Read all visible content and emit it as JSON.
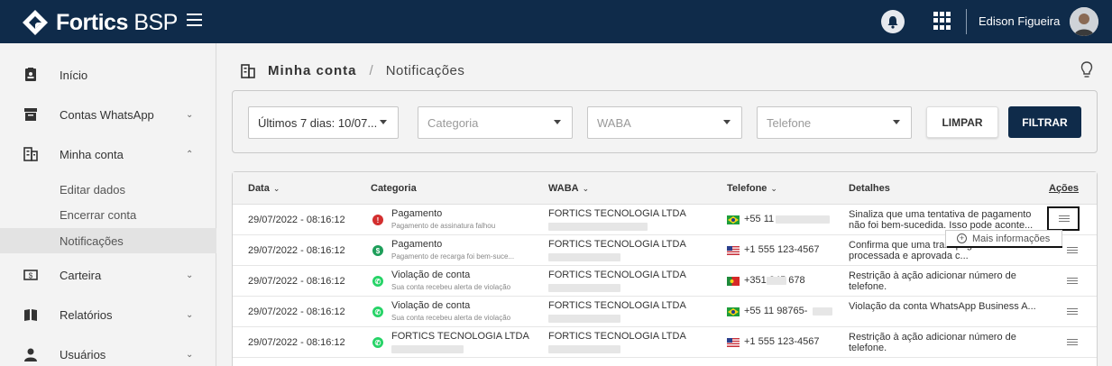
{
  "app": {
    "brand_bold": "Fortics",
    "brand_light": "BSP"
  },
  "header": {
    "user_name": "Edison Figueira"
  },
  "sidebar": {
    "items": [
      {
        "label": "Início",
        "icon": "badge-icon"
      },
      {
        "label": "Contas WhatsApp",
        "icon": "archive-icon"
      },
      {
        "label": "Minha conta",
        "icon": "building-icon"
      },
      {
        "label": "Carteira",
        "icon": "wallet-icon"
      },
      {
        "label": "Relatórios",
        "icon": "book-icon"
      },
      {
        "label": "Usuários",
        "icon": "user-icon"
      }
    ],
    "subitems": [
      "Editar dados",
      "Encerrar conta",
      "Notificações"
    ]
  },
  "breadcrumb": {
    "root": "Minha conta",
    "separator": "/",
    "current": "Notificações"
  },
  "filters": {
    "period": "Últimos 7 dias: 10/07...",
    "categoria_placeholder": "Categoria",
    "waba_placeholder": "WABA",
    "telefone_placeholder": "Telefone",
    "clear_label": "LIMPAR",
    "filter_label": "FILTRAR"
  },
  "table": {
    "headers": {
      "data": "Data",
      "categoria": "Categoria",
      "waba": "WABA",
      "telefone": "Telefone",
      "detalhes": "Detalhes",
      "acoes": "Ações"
    },
    "rows": [
      {
        "date": "29/07/2022 - 08:16:12",
        "cat_title": "Pagamento",
        "cat_sub": "Pagamento de assinatura falhou",
        "cat_icon": "error",
        "waba": "FORTICS TECNOLOGIA LTDA",
        "flag": "br",
        "phone": "+55 11",
        "details": "Sinaliza que uma tentativa de pagamento não foi bem-sucedida. Isso pode aconte..."
      },
      {
        "date": "29/07/2022 - 08:16:12",
        "cat_title": "Pagamento",
        "cat_sub": "Pagamento de recarga foi bem-suce...",
        "cat_icon": "success",
        "waba": "FORTICS TECNOLOGIA LTDA",
        "flag": "us",
        "phone": "+1 555 123-4567",
        "details": "Confirma que uma tra... pagamento foi processada e aprovada c..."
      },
      {
        "date": "29/07/2022 - 08:16:12",
        "cat_title": "Violação de conta",
        "cat_sub": "Sua conta recebeu alerta de violação",
        "cat_icon": "whatsapp",
        "waba": "FORTICS TECNOLOGIA LTDA",
        "flag": "pt",
        "phone": "+351       345 678",
        "details": "Restrição à ação adicionar número de telefone."
      },
      {
        "date": "29/07/2022 - 08:16:12",
        "cat_title": "Violação de conta",
        "cat_sub": "Sua conta recebeu alerta de violação",
        "cat_icon": "whatsapp",
        "waba": "FORTICS TECNOLOGIA LTDA",
        "flag": "br",
        "phone": "+55 11 98765-",
        "details": "Violação da conta WhatsApp Business A..."
      },
      {
        "date": "29/07/2022 - 08:16:12",
        "cat_title": "FORTICS TECNOLOGIA LTDA",
        "cat_sub": "",
        "cat_icon": "whatsapp",
        "waba": "FORTICS TECNOLOGIA LTDA",
        "flag": "us",
        "phone": "+1 555 123-4567",
        "details": "Restrição à ação adicionar número de telefone."
      }
    ]
  },
  "tooltip": {
    "label": "Mais informações"
  },
  "colors": {
    "navy": "#0f2b4a",
    "error": "#d32f2f",
    "success": "#1e9e5a",
    "whatsapp": "#25d366"
  }
}
